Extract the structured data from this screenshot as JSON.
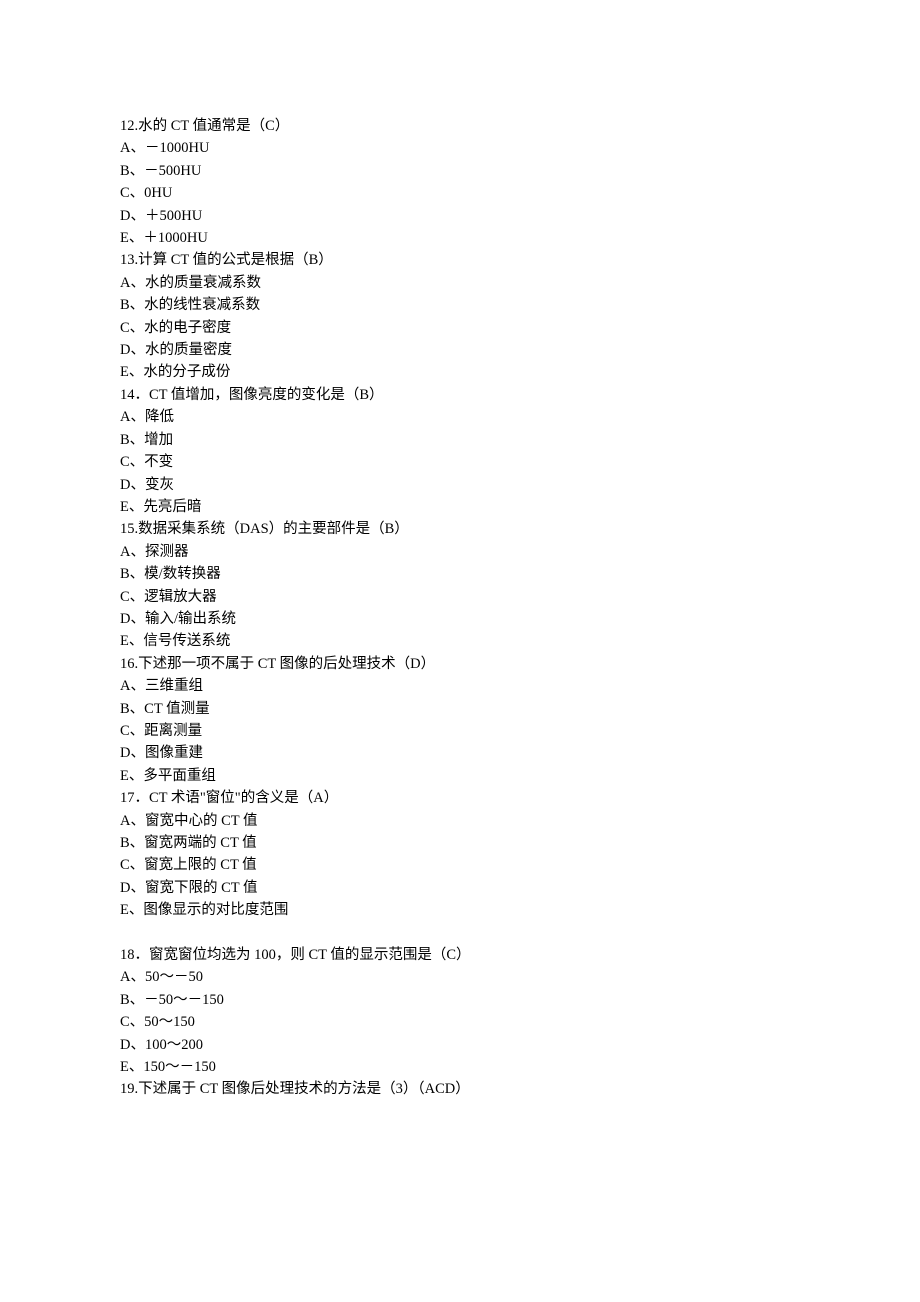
{
  "questions": [
    {
      "stem": "12.水的 CT 值通常是（C）",
      "options": [
        "A、－1000HU",
        "B、－500HU",
        "C、0HU",
        "D、＋500HU",
        "E、＋1000HU"
      ]
    },
    {
      "stem": "13.计算 CT 值的公式是根据（B）",
      "options": [
        "A、水的质量衰减系数",
        "B、水的线性衰减系数",
        "C、水的电子密度",
        "D、水的质量密度",
        "E、水的分子成份"
      ]
    },
    {
      "stem": "14．CT 值增加，图像亮度的变化是（B）",
      "options": [
        "A、降低",
        "B、增加",
        "C、不变",
        "D、变灰",
        "E、先亮后暗"
      ]
    },
    {
      "stem": "15.数据采集系统（DAS）的主要部件是（B）",
      "options": [
        "A、探测器",
        "B、模/数转换器",
        "C、逻辑放大器",
        "D、输入/输出系统",
        "E、信号传送系统"
      ]
    },
    {
      "stem": "16.下述那一项不属于 CT 图像的后处理技术（D）",
      "options": [
        "A、三维重组",
        "B、CT 值测量",
        "C、距离测量",
        "D、图像重建",
        "E、多平面重组"
      ]
    },
    {
      "stem": "17．CT 术语\"窗位\"的含义是（A）",
      "options": [
        "A、窗宽中心的 CT 值",
        "B、窗宽两端的 CT 值",
        "C、窗宽上限的 CT 值",
        "D、窗宽下限的 CT 值",
        "E、图像显示的对比度范围"
      ]
    },
    {
      "blank_before": true,
      "stem": "18．窗宽窗位均选为 100，则 CT 值的显示范围是（C）",
      "options": [
        "A、50～－50",
        "B、－50～－150",
        "C、50～150",
        "D、100～200",
        "E、150～－150"
      ]
    },
    {
      "stem": "19.下述属于 CT 图像后处理技术的方法是（3）（ACD）",
      "options": []
    }
  ]
}
